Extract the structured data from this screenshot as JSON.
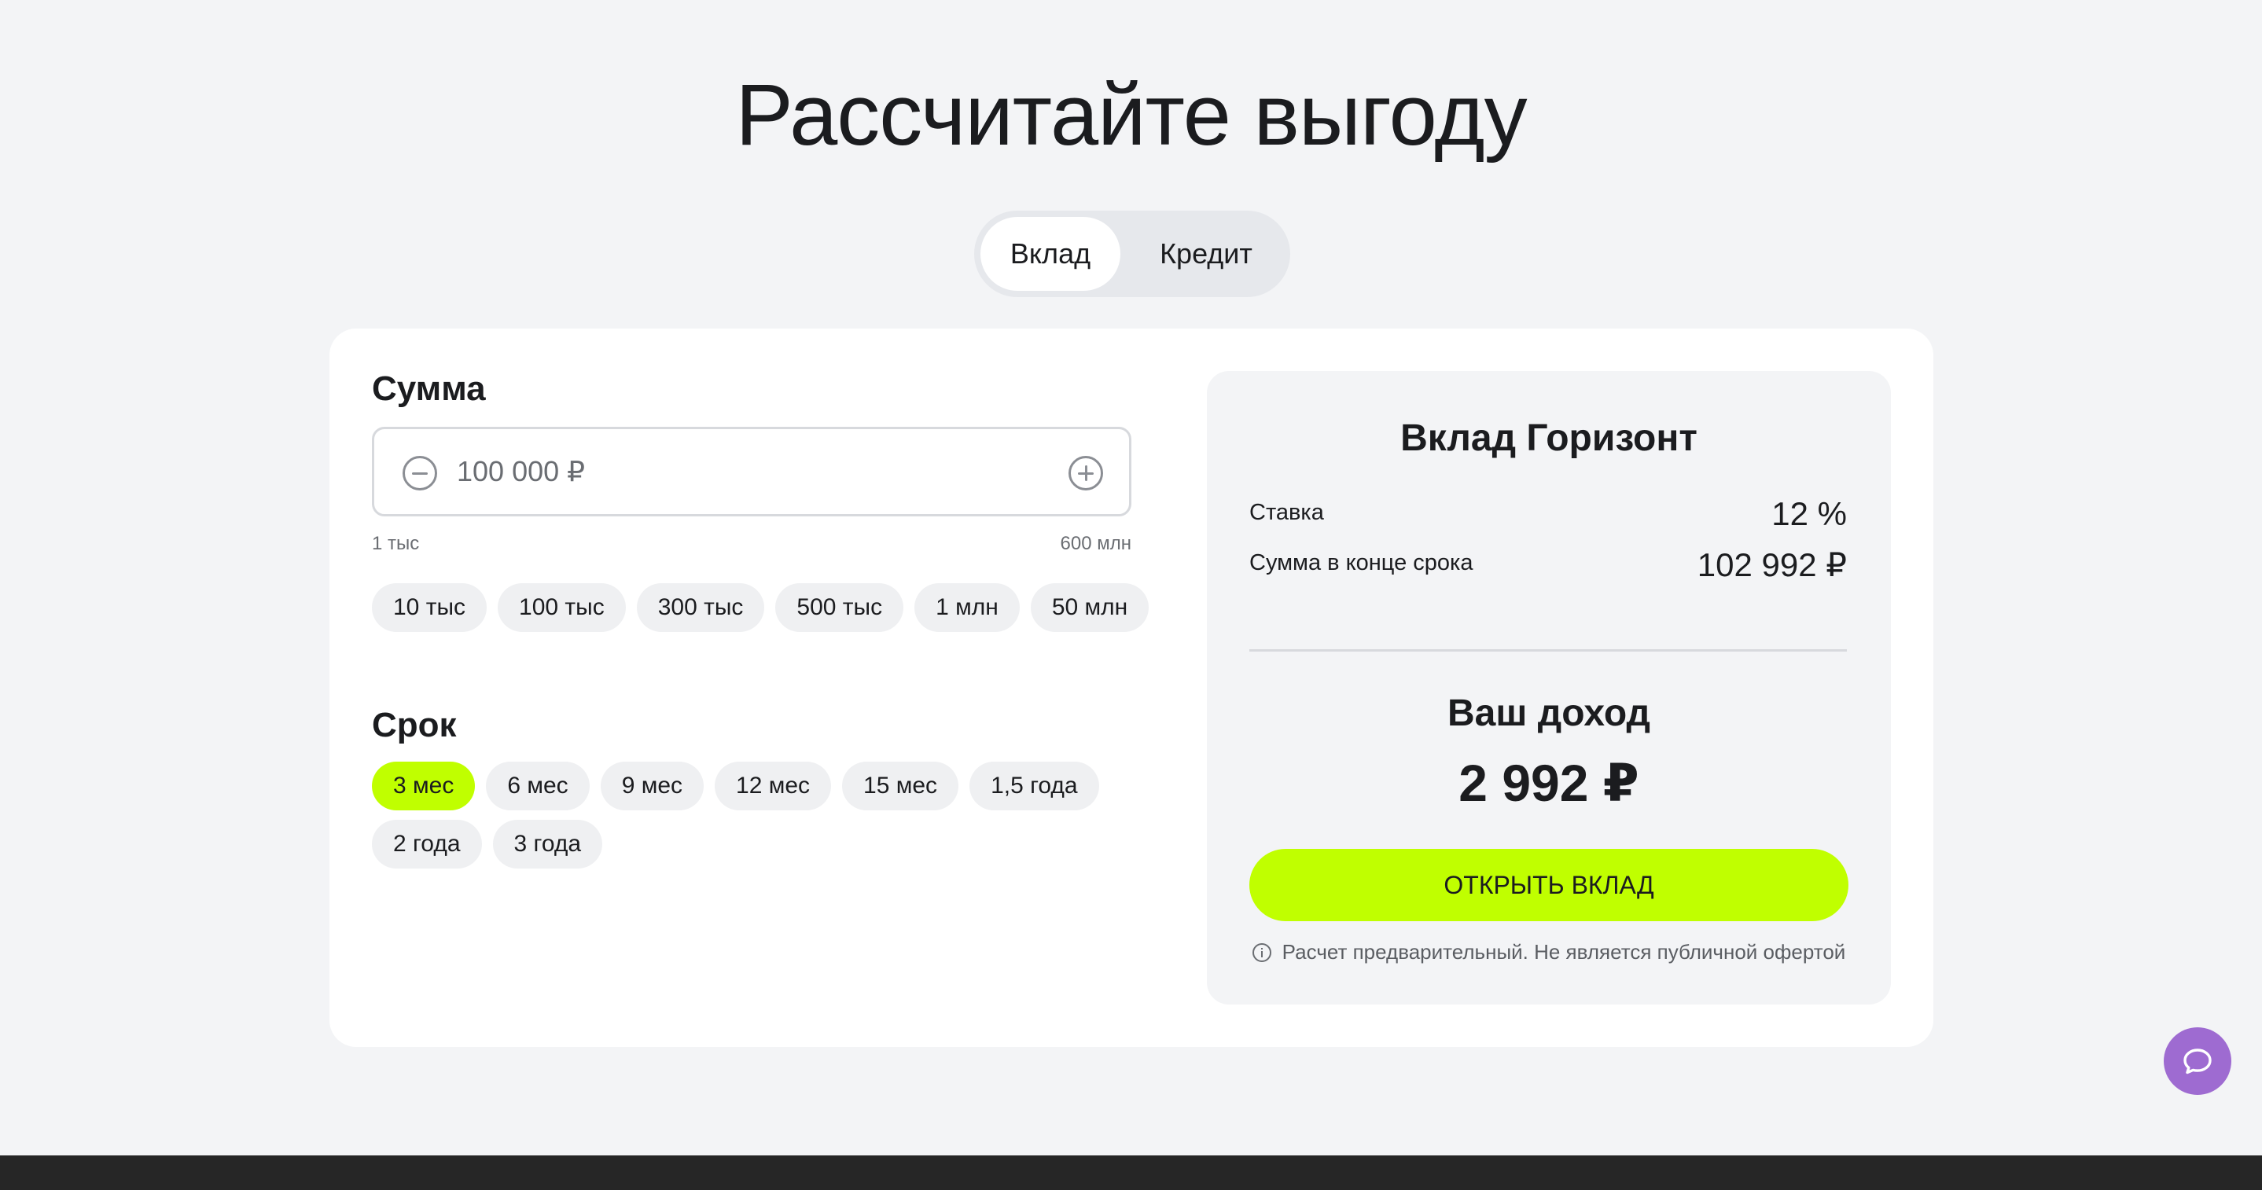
{
  "page": {
    "title": "Рассчитайте выгоду"
  },
  "mode_switch": {
    "tabs": [
      "Вклад",
      "Кредит"
    ],
    "active": "Вклад"
  },
  "amount": {
    "title": "Сумма",
    "value": "100 000 ₽",
    "min_label": "1 тыс",
    "max_label": "600 млн",
    "presets": [
      "10 тыс",
      "100 тыс",
      "300 тыс",
      "500 тыс",
      "1 млн",
      "50 млн"
    ]
  },
  "term": {
    "title": "Срок",
    "options_row1": [
      "3 мес",
      "6 мес",
      "9 мес",
      "12 мес",
      "15 мес",
      "1,5 года"
    ],
    "options_row2": [
      "2 года",
      "3 года"
    ],
    "selected": "3 мес"
  },
  "result": {
    "product_title": "Вклад Горизонт",
    "rate_label": "Ставка",
    "rate_value": "12 %",
    "end_sum_label": "Сумма в конце срока",
    "end_sum_value": "102 992 ₽",
    "income_title": "Ваш доход",
    "income_value": "2 992 ₽",
    "open_button": "ОТКРЫТЬ ВКЛАД",
    "disclaimer": "Расчет предварительный. Не является публичной офертой"
  },
  "icons": {
    "minus": "minus-circle-icon",
    "plus": "plus-circle-icon",
    "info": "info-icon",
    "chat": "chat-bubble-icon"
  },
  "colors": {
    "accent": "#c0ff00",
    "chat": "#9e6bd1",
    "background": "#f3f4f6",
    "card": "#ffffff"
  }
}
